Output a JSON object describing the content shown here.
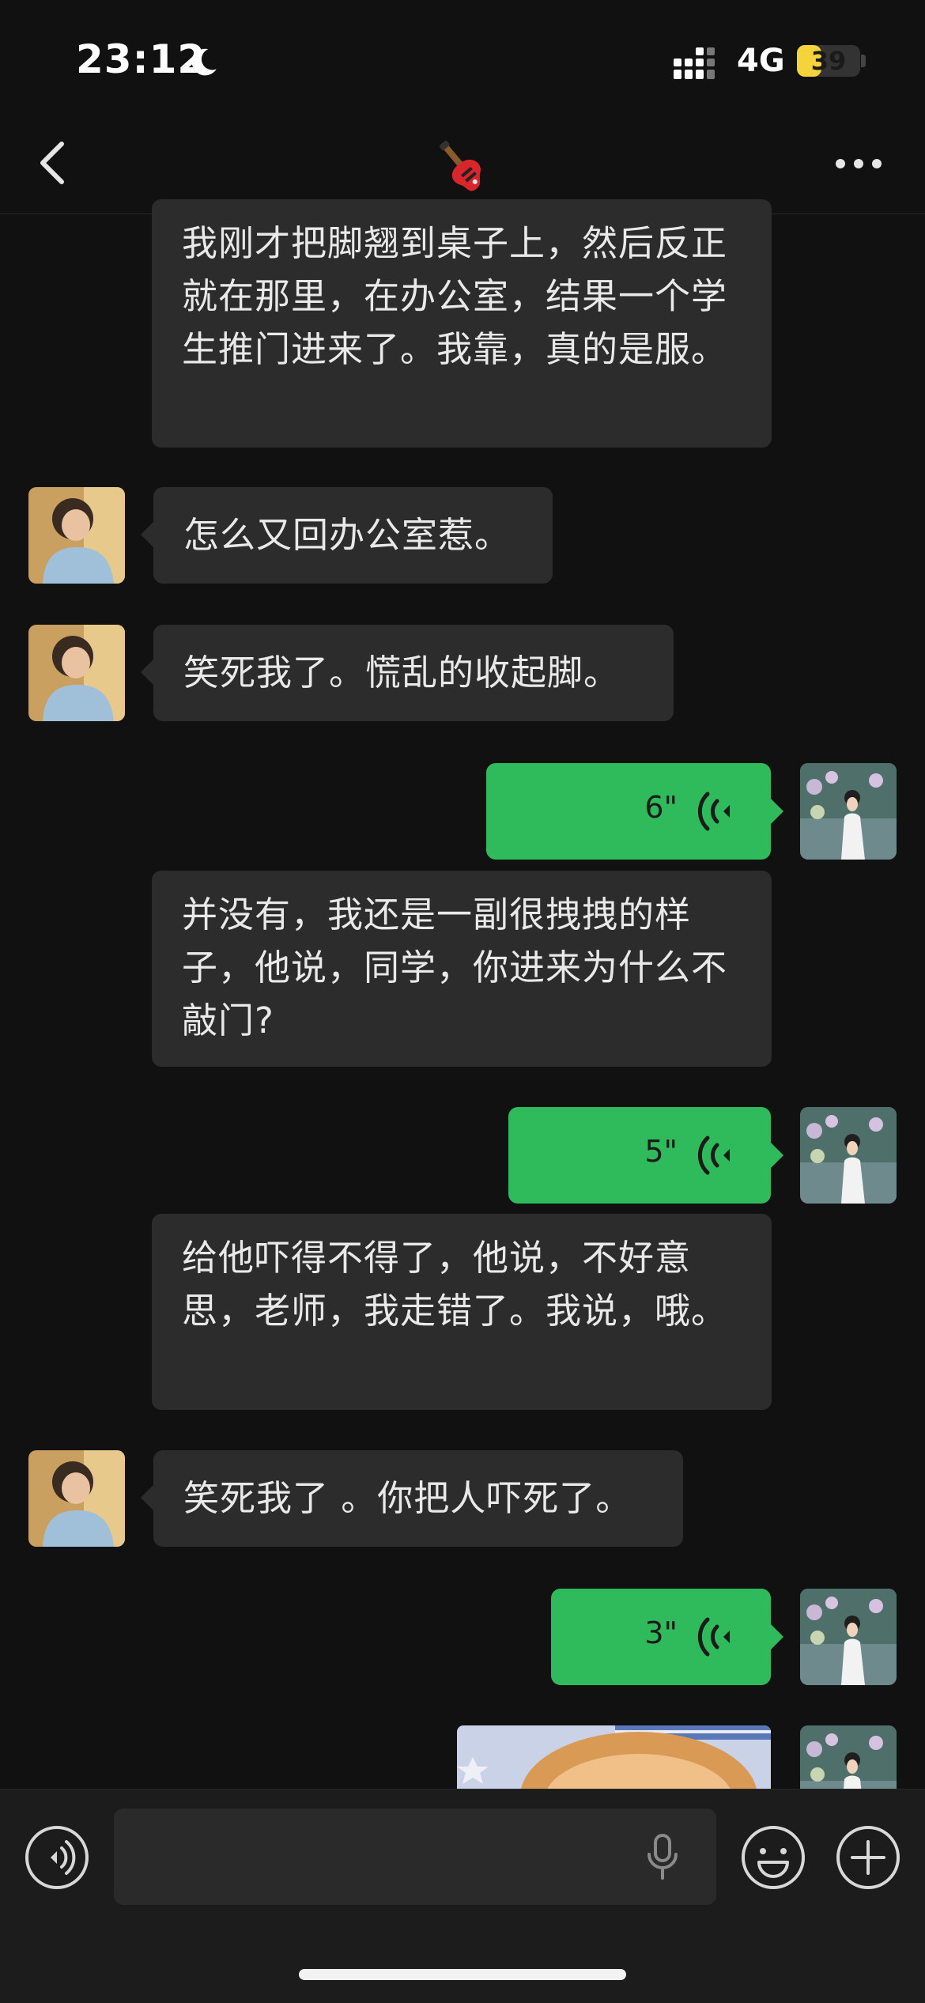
{
  "status_bar": {
    "time": "23:12",
    "network": "4G",
    "battery": "39",
    "battery_level_percent": 39
  },
  "nav": {
    "title_icon": "electric-guitar-emoji",
    "back_icon": "chevron-left-icon",
    "more_icon": "more-dots-icon"
  },
  "messages": [
    {
      "side": "left",
      "type": "text",
      "avatar": false,
      "text": "我刚才把脚翘到桌子上，然后反正就在那里，在办公室，结果一个学生推门进来了。我靠，真的是服。"
    },
    {
      "side": "left",
      "type": "text",
      "avatar": true,
      "text": "怎么又回办公室惹。"
    },
    {
      "side": "left",
      "type": "text",
      "avatar": true,
      "text": "笑死我了。慌乱的收起脚。"
    },
    {
      "side": "right",
      "type": "voice",
      "duration": "6\""
    },
    {
      "side": "left",
      "type": "text",
      "avatar": false,
      "text": "并没有，我还是一副很拽拽的样子，他说，同学，你进来为什么不敲门?"
    },
    {
      "side": "right",
      "type": "voice",
      "duration": "5\""
    },
    {
      "side": "left",
      "type": "text",
      "avatar": false,
      "text": "给他吓得不得了，他说，不好意思，老师，我走错了。我说，哦。"
    },
    {
      "side": "left",
      "type": "text",
      "avatar": true,
      "text": "笑死我了 。你把人吓死了。"
    },
    {
      "side": "right",
      "type": "voice",
      "duration": "3\""
    },
    {
      "side": "right",
      "type": "image",
      "image": "cat-photo"
    }
  ],
  "input_bar": {
    "voice_toggle_icon": "voice-mode-icon",
    "mic_icon": "microphone-icon",
    "emoji_icon": "emoji-icon",
    "plus_icon": "plus-icon",
    "placeholder": ""
  },
  "colors": {
    "background": "#111111",
    "bubble_left": "#2c2c2c",
    "bubble_voice": "#2fbb5c",
    "input_bar": "#1c1c1c"
  }
}
